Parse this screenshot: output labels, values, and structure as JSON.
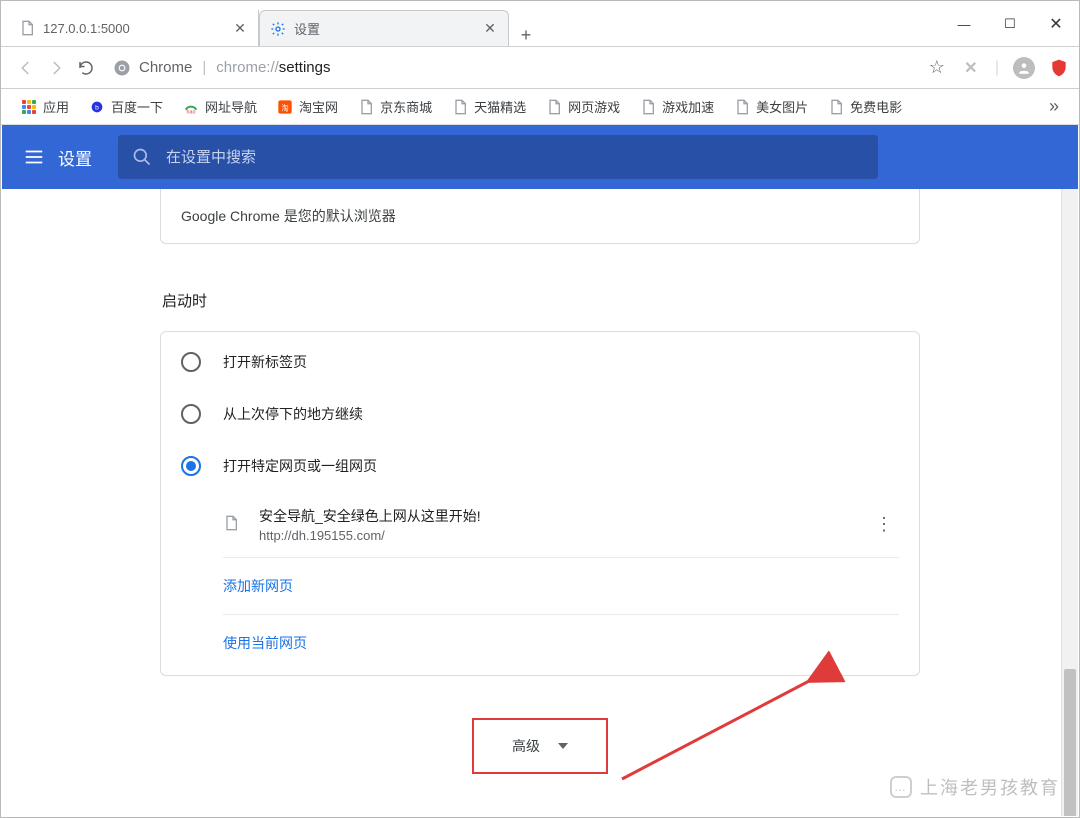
{
  "window": {
    "minimize": "—",
    "maximize": "☐",
    "close": "✕"
  },
  "tabs": {
    "t0": {
      "label": "127.0.0.1:5000"
    },
    "t1": {
      "label": "设置"
    },
    "new": "+"
  },
  "omnibox": {
    "secure_label": "Chrome",
    "url_scheme": "chrome://",
    "url_path": "settings"
  },
  "bookmarks": {
    "apps": "应用",
    "items": [
      {
        "label": "百度一下"
      },
      {
        "label": "网址导航"
      },
      {
        "label": "淘宝网"
      },
      {
        "label": "京东商城"
      },
      {
        "label": "天猫精选"
      },
      {
        "label": "网页游戏"
      },
      {
        "label": "游戏加速"
      },
      {
        "label": "美女图片"
      },
      {
        "label": "免费电影"
      }
    ],
    "more": "»"
  },
  "toolbar": {
    "title": "设置",
    "search_placeholder": "在设置中搜索"
  },
  "default_browser": {
    "text": "Google Chrome 是您的默认浏览器"
  },
  "startup": {
    "title": "启动时",
    "opt0": "打开新标签页",
    "opt1": "从上次停下的地方继续",
    "opt2": "打开特定网页或一组网页",
    "page": {
      "title": "安全导航_安全绿色上网从这里开始!",
      "url": "http://dh.195155.com/"
    },
    "add_page": "添加新网页",
    "use_current": "使用当前网页"
  },
  "advanced": {
    "label": "高级"
  },
  "watermark": {
    "text": "上海老男孩教育"
  }
}
